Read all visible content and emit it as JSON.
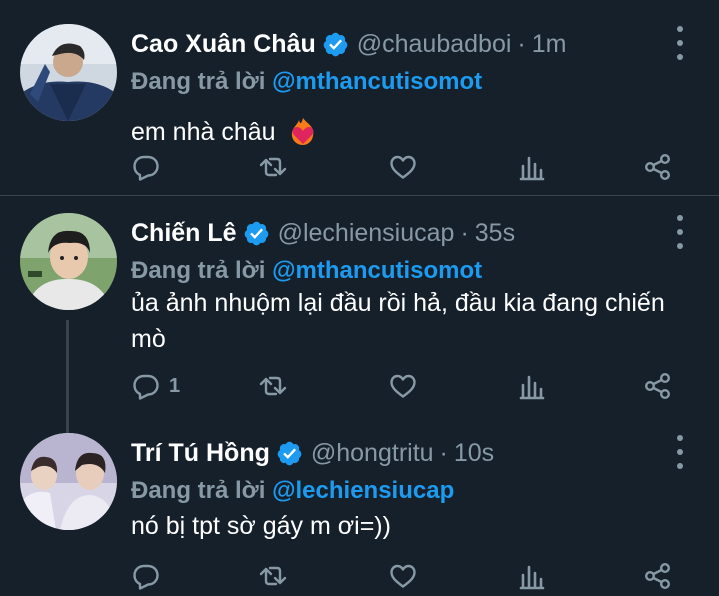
{
  "tweets": [
    {
      "name": "Cao Xuân Châu",
      "handle": "@chaubadboi",
      "time": "1m",
      "reply_label": "Đang trả lời",
      "reply_to": "@mthancutisomot",
      "text": "em nhà châu",
      "emoji": "heart-on-fire",
      "reply_count": ""
    },
    {
      "name": "Chiến Lê",
      "handle": "@lechiensiucap",
      "time": "35s",
      "reply_label": "Đang trả lời",
      "reply_to": "@mthancutisomot",
      "text": "ủa ảnh nhuộm lại đầu rồi hả, đầu kia đang chiến mò",
      "reply_count": "1"
    },
    {
      "name": "Trí Tú Hồng",
      "handle": "@hongtritu",
      "time": "10s",
      "reply_label": "Đang trả lời",
      "reply_to": "@lechiensiucap",
      "text": "nó bị tpt sờ gáy m ơi=))",
      "reply_count": ""
    }
  ],
  "separator": "·",
  "colors": {
    "background": "#15202b",
    "primary_text": "#ffffff",
    "secondary_text": "#8899a6",
    "accent": "#1d9bf0",
    "divider": "#38444d"
  }
}
